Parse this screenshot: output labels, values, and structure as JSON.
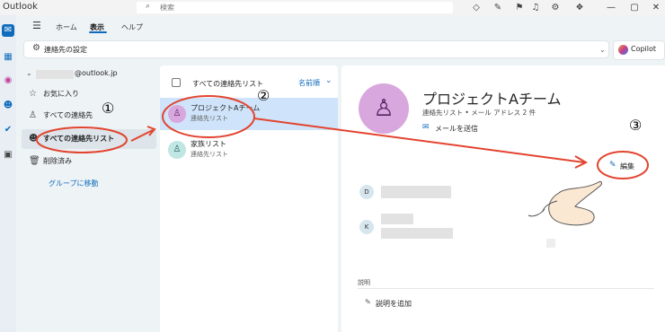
{
  "app": {
    "title": "Outlook"
  },
  "search": {
    "placeholder": "検索"
  },
  "ribbon": {
    "tabs": [
      "ホーム",
      "表示",
      "ヘルプ"
    ],
    "settings_label": "連絡先の設定",
    "copilot_label": "Copilot"
  },
  "folders": {
    "account": "@outlook.jp",
    "items": [
      "お気に入り",
      "すべての連絡先",
      "すべての連絡先リスト",
      "削除済み"
    ],
    "link": "グループに移動"
  },
  "list": {
    "header": "すべての連絡先リスト",
    "sort": "名前順",
    "rows": [
      {
        "name": "プロジェクトAチーム",
        "sub": "連絡先リスト"
      },
      {
        "name": "家族リスト",
        "sub": "連絡先リスト"
      }
    ]
  },
  "detail": {
    "title": "プロジェクトAチーム",
    "subtitle": "連絡先リスト • メール アドレス 2 件",
    "send_mail": "メールを送信",
    "edit": "編集",
    "members": [
      "D",
      "K"
    ],
    "description_label": "説明",
    "add_description": "説明を追加"
  },
  "annotations": {
    "numbers": [
      "①",
      "②",
      "③"
    ]
  },
  "colors": {
    "accent": "#0f6cbd",
    "annotation": "#e2442f",
    "avatar_list": "#d8a7dd",
    "avatar_family": "#bfe6e2",
    "selected_row": "#cfe4fa"
  }
}
